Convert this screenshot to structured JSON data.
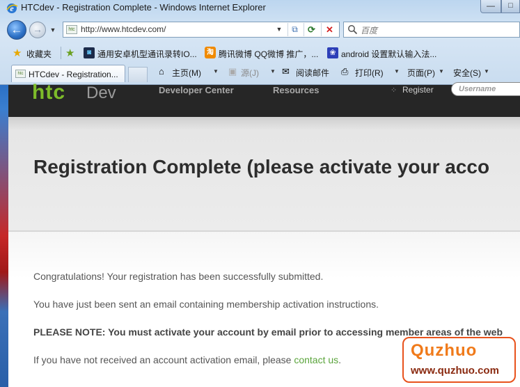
{
  "window": {
    "title": "HTCdev - Registration Complete - Windows Internet Explorer",
    "minimize_glyph": "—",
    "maximize_glyph": "□"
  },
  "navbar": {
    "url": "http://www.htcdev.com/",
    "search_placeholder": "百度",
    "favicon_text": "htc"
  },
  "favorites_bar": {
    "label": "收藏夹",
    "links": [
      "通用安卓机型通讯录转IO...",
      "腾讯微博 QQ微博 推广，...",
      "android 设置默认输入法..."
    ],
    "icon_glyphs": [
      "◙",
      "淘",
      "❀"
    ]
  },
  "tabs": {
    "active_label": "HTCdev - Registration...",
    "favicon_text": "htc"
  },
  "command_bar": {
    "home": "主页(M)",
    "feeds": "源(J)",
    "read_mail": "阅读邮件",
    "print": "打印(R)",
    "page": "页面(P)",
    "safety": "安全(S)"
  },
  "site": {
    "logo_htc": "htc",
    "logo_dev": "Dev",
    "nav": [
      "Developer Center",
      "Resources"
    ],
    "register": "Register",
    "username_placeholder": "Username"
  },
  "main": {
    "title": "Registration Complete (please activate your acco",
    "paragraphs": [
      "Congratulations! Your registration has been successfully submitted.",
      "You have just been sent an email containing membership activation instructions.",
      "PLEASE NOTE: You must activate your account by email prior to accessing member areas of the web"
    ],
    "activation_text": "If you have not received an account activation email, please",
    "contact_link": "contact us",
    "period": "."
  },
  "watermark": {
    "brand": "Quzhuo",
    "url": "www.quzhuo.com"
  },
  "colors": {
    "header_bg": "#262626",
    "logo_green": "#7dbb2a",
    "link_green": "#5aa43b",
    "title_text": "#2d2d2d",
    "watermark_orange": "#e8521c"
  }
}
